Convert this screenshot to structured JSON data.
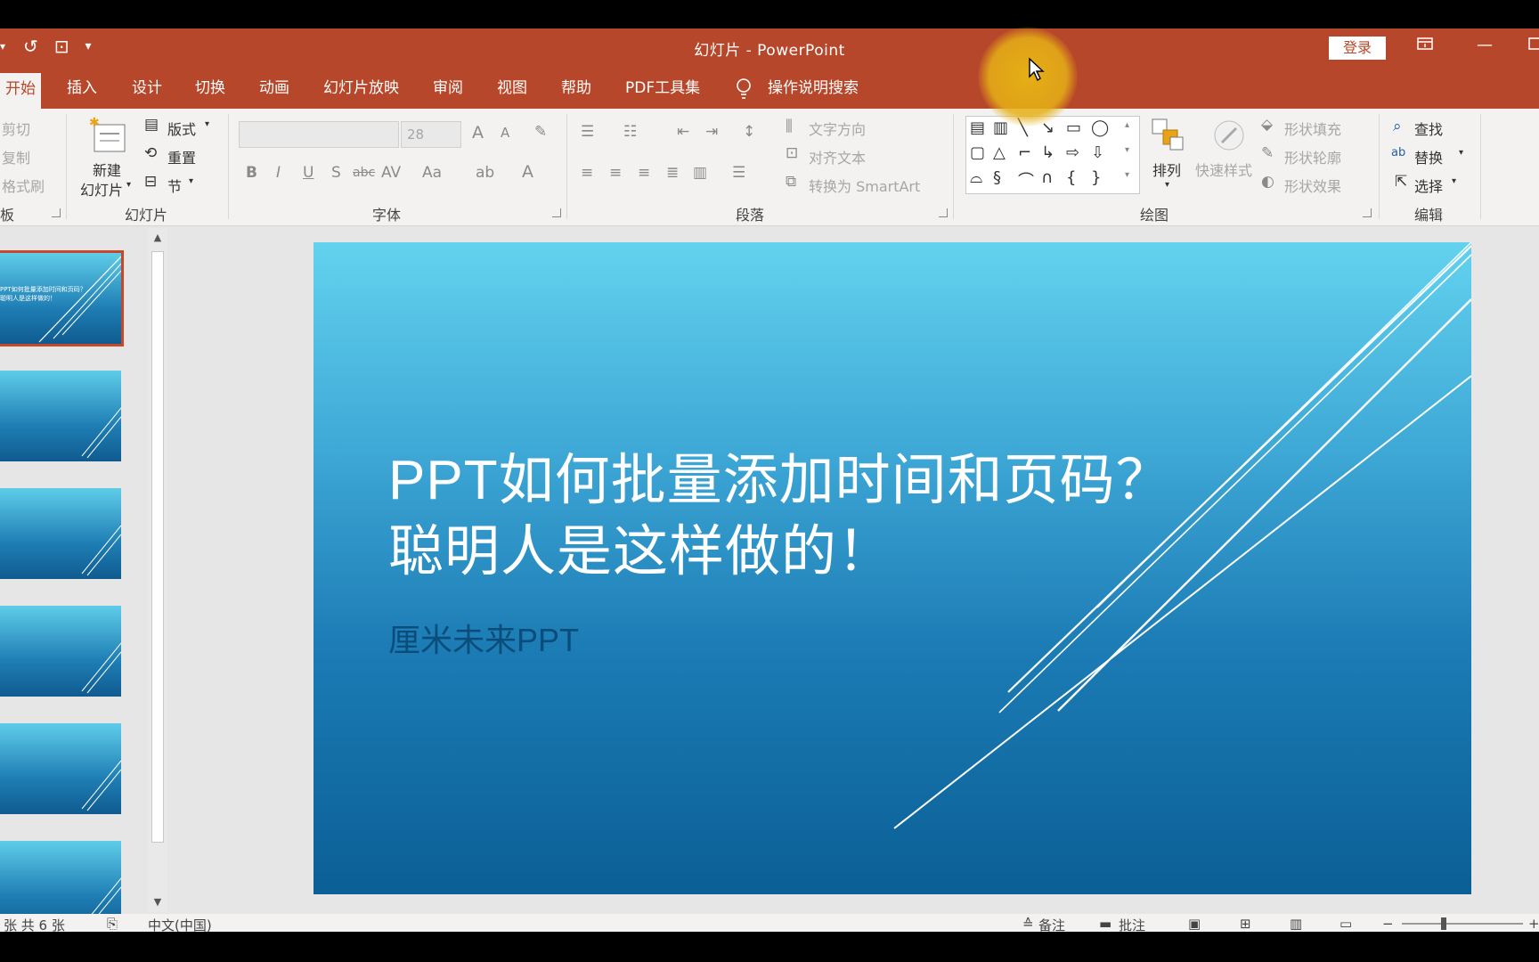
{
  "window": {
    "title": "幻灯片  -  PowerPoint",
    "login_label": "登录",
    "restore_icon": "ribbon-display-icon",
    "minimize_glyph": "—"
  },
  "qat": {
    "undo_glyph": "↺",
    "present_glyph": "⊡",
    "customize_glyph": "▾"
  },
  "tabs": [
    {
      "label": "开始",
      "active": true
    },
    {
      "label": "插入"
    },
    {
      "label": "设计"
    },
    {
      "label": "切换"
    },
    {
      "label": "动画"
    },
    {
      "label": "幻灯片放映"
    },
    {
      "label": "审阅"
    },
    {
      "label": "视图"
    },
    {
      "label": "帮助"
    },
    {
      "label": "PDF工具集"
    },
    {
      "label": "操作说明搜索"
    }
  ],
  "ribbon": {
    "clipboard": {
      "cut": "剪切",
      "copy": "复制",
      "format_painter": "格式刷",
      "label": "板"
    },
    "slides": {
      "new_slide_line1": "新建",
      "new_slide_line2": "幻灯片",
      "layout": "版式",
      "reset": "重置",
      "section": "节",
      "label": "幻灯片"
    },
    "font": {
      "size": "28",
      "bold": "B",
      "italic": "I",
      "underline": "U",
      "shadow": "S",
      "strike": "abc",
      "spacing": "AV",
      "case": "Aa",
      "grow": "A",
      "shrink": "A",
      "color": "A",
      "label": "字体"
    },
    "paragraph": {
      "text_direction": "文字方向",
      "align_text": "对齐文本",
      "smartart": "转换为 SmartArt",
      "label": "段落"
    },
    "drawing": {
      "arrange": "排列",
      "quick_styles": "快速样式",
      "shape_fill": "形状填充",
      "shape_outline": "形状轮廓",
      "shape_effects": "形状效果",
      "label": "绘图"
    },
    "editing": {
      "find": "查找",
      "replace": "替换",
      "select": "选择",
      "label": "编辑"
    }
  },
  "slides_pane": {
    "thumb1_title": "PPT如何批量添加时间和页码？聪明人是这样做的！",
    "count": 6,
    "selected": 1
  },
  "slide": {
    "title_line1": "PPT如何批量添加时间和页码？",
    "title_line2": "聪明人是这样做的！",
    "subtitle": "厘米未来PPT"
  },
  "statusbar": {
    "slide_pos": "张  共 6 张",
    "language": "中文(中国)",
    "notes": "备注",
    "comments": "批注"
  },
  "colors": {
    "accent": "#b7472a",
    "ribbon_bg": "#f3f2f1",
    "slide_top": "#63d2ee",
    "slide_bottom": "#0b5f96",
    "subtitle": "#0b4d7a"
  }
}
